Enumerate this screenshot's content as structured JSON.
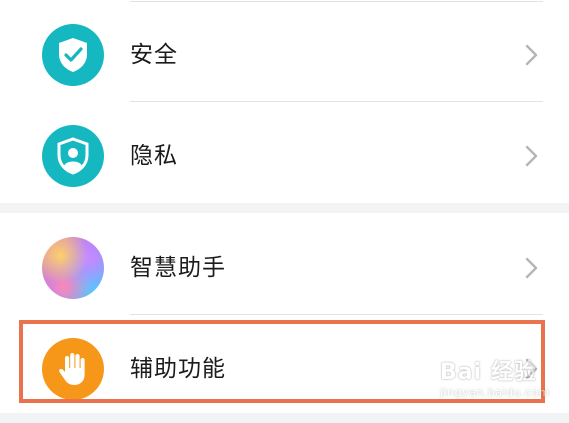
{
  "groups": [
    {
      "items": [
        {
          "label": "安全",
          "icon": "shield-check-icon",
          "icon_color": "#15b8c0"
        },
        {
          "label": "隐私",
          "icon": "shield-person-icon",
          "icon_color": "#15b8c0"
        }
      ]
    },
    {
      "items": [
        {
          "label": "智慧助手",
          "icon": "smart-assistant-icon",
          "icon_color": "#a97cff"
        },
        {
          "label": "辅助功能",
          "icon": "hand-icon",
          "icon_color": "#f7971a",
          "highlighted": true
        }
      ]
    }
  ],
  "highlight_color": "#e8734d",
  "watermark": {
    "main": "Bai 经验",
    "sub": "jingyan.baidu.com"
  }
}
